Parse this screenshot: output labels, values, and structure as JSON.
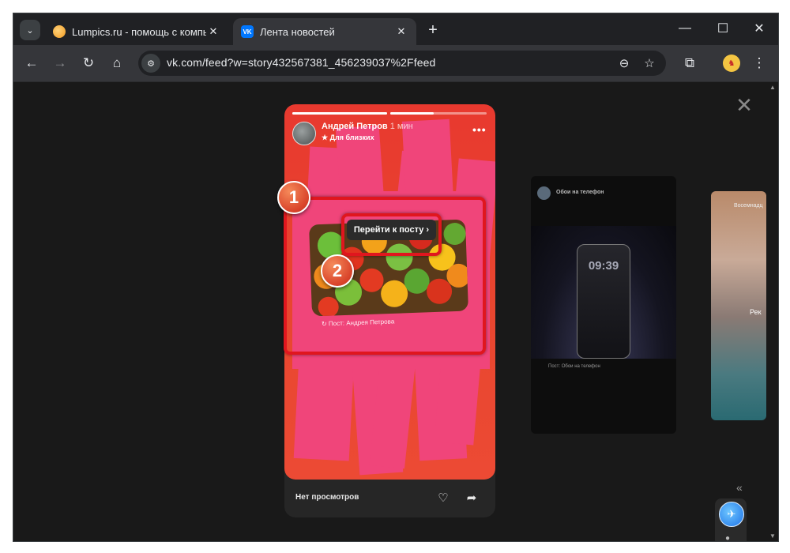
{
  "browser": {
    "tabs": [
      {
        "title": "Lumpics.ru - помощь с компь",
        "favicon": "orange-circle-icon",
        "active": false
      },
      {
        "title": "Лента новостей",
        "favicon": "vk-logo-icon",
        "active": true
      }
    ],
    "url": "vk.com/feed?w=story432567381_456239037%2Ffeed"
  },
  "story": {
    "author": "Андрей Петров",
    "time": "1 мин",
    "audience": "Для близких",
    "goto_post_label": "Перейти к посту ›",
    "post_caption": "Пост: Андрея Петрова",
    "views_label": "Нет просмотров",
    "progress": [
      1.0,
      0.45
    ]
  },
  "next_story": {
    "author": "Обои на телефон",
    "clock": "09:39",
    "caption": "Пост: Обои на телефон"
  },
  "third_story": {
    "author": "Восемнадц",
    "text": "Рек"
  },
  "annotations": {
    "badge1": "1",
    "badge2": "2",
    "color": "#e0161e"
  }
}
